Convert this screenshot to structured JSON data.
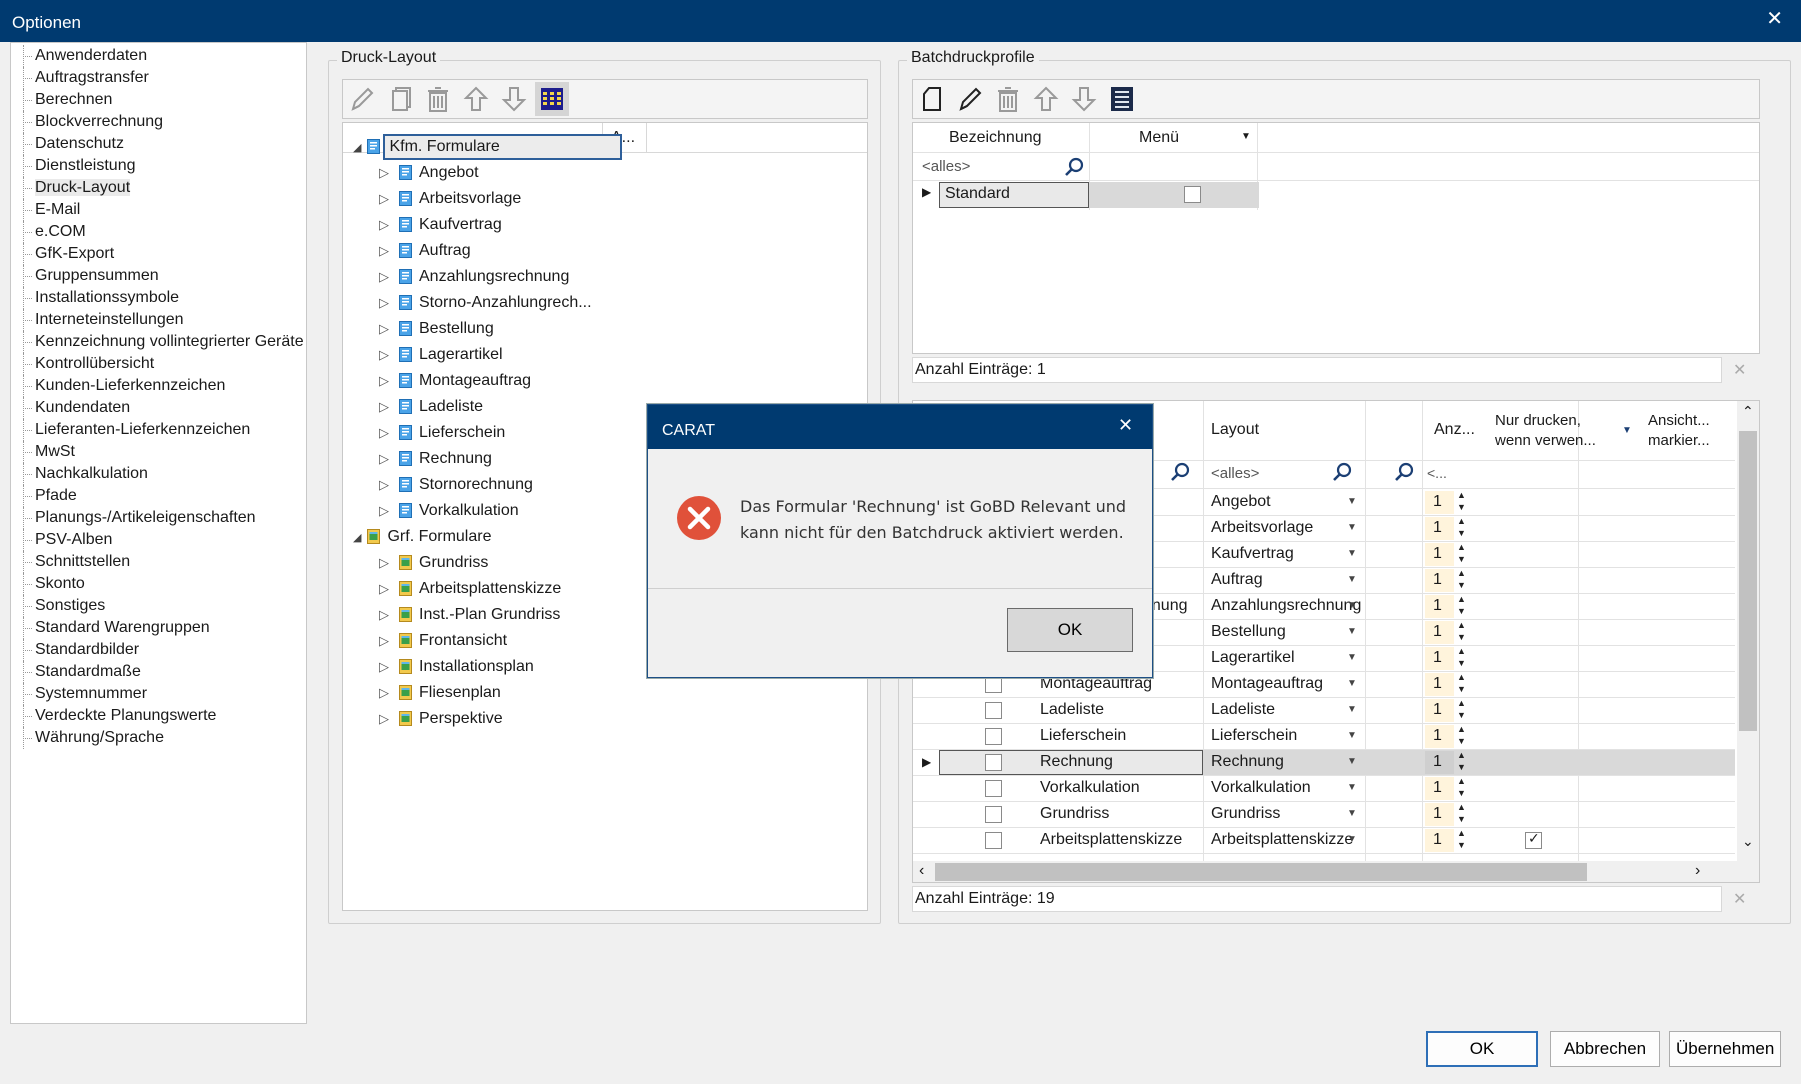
{
  "window": {
    "title": "Optionen",
    "close_glyph": "✕"
  },
  "nav": {
    "items": [
      "Anwenderdaten",
      "Auftragstransfer",
      "Berechnen",
      "Blockverrechnung",
      "Datenschutz",
      "Dienstleistung",
      "Druck-Layout",
      "E-Mail",
      "e.COM",
      "GfK-Export",
      "Gruppensummen",
      "Installationssymbole",
      "Interneteinstellungen",
      "Kennzeichnung vollintegrierter Geräte",
      "Kontrollübersicht",
      "Kunden-Lieferkennzeichen",
      "Kundendaten",
      "Lieferanten-Lieferkennzeichen",
      "MwSt",
      "Nachkalkulation",
      "Pfade",
      "Planungs-/Artikeleigenschaften",
      "PSV-Alben",
      "Schnittstellen",
      "Skonto",
      "Sonstiges",
      "Standard Warengruppen",
      "Standardbilder",
      "Standardmaße",
      "Systemnummer",
      "Verdeckte Planungswerte",
      "Währung/Sprache"
    ],
    "selected": "Druck-Layout"
  },
  "druck_layout": {
    "label": "Druck-Layout",
    "column_header": "A...",
    "kfm": {
      "label": "Kfm. Formulare",
      "items": [
        "Angebot",
        "Arbeitsvorlage",
        "Kaufvertrag",
        "Auftrag",
        "Anzahlungsrechnung",
        "Storno-Anzahlungrech...",
        "Bestellung",
        "Lagerartikel",
        "Montageauftrag",
        "Ladeliste",
        "Lieferschein",
        "Rechnung",
        "Stornorechnung",
        "Vorkalkulation"
      ]
    },
    "grf": {
      "label": "Grf. Formulare",
      "items": [
        "Grundriss",
        "Arbeitsplattenskizze",
        "Inst.-Plan Grundriss",
        "Frontansicht",
        "Installationsplan",
        "Fliesenplan",
        "Perspektive"
      ]
    },
    "icons": [
      "pencil-icon",
      "copy-icon",
      "trash-icon",
      "arrow-up-icon",
      "arrow-down-icon",
      "grid-icon"
    ]
  },
  "batch": {
    "label": "Batchdruckprofile",
    "headers": {
      "bezeichnung": "Bezeichnung",
      "menu": "Menü"
    },
    "filter_placeholder": "<alles>",
    "rows": [
      {
        "name": "Standard",
        "menu": false
      }
    ],
    "count_label": "Anzahl Einträge: 1"
  },
  "layouts": {
    "headers": {
      "layout": "Layout",
      "anz": "Anz...",
      "nur_drucken": "Nur drucken,\nwenn verwen...",
      "ansicht": "Ansicht...\nmarkier..."
    },
    "filter_all": "<alles>",
    "filter_short": "<...",
    "rows": [
      {
        "name": "",
        "layout": "Angebot",
        "qty": "1",
        "check": false,
        "show_checkbox": false
      },
      {
        "name": "",
        "layout": "Arbeitsvorlage",
        "qty": "1",
        "check": false,
        "show_checkbox": false
      },
      {
        "name": "",
        "layout": "Kaufvertrag",
        "qty": "1",
        "check": false,
        "show_checkbox": false
      },
      {
        "name": "",
        "layout": "Auftrag",
        "qty": "1",
        "check": false,
        "show_checkbox": false
      },
      {
        "name": "nnung",
        "layout": "Anzahlungsrechnung",
        "qty": "1",
        "check": false,
        "show_checkbox": false
      },
      {
        "name": "",
        "layout": "Bestellung",
        "qty": "1",
        "check": false,
        "show_checkbox": false
      },
      {
        "name": "",
        "layout": "Lagerartikel",
        "qty": "1",
        "check": false,
        "show_checkbox": false
      },
      {
        "name": "Montageauftrag",
        "layout": "Montageauftrag",
        "qty": "1",
        "check": false,
        "show_checkbox": true
      },
      {
        "name": "Ladeliste",
        "layout": "Ladeliste",
        "qty": "1",
        "check": false,
        "show_checkbox": true
      },
      {
        "name": "Lieferschein",
        "layout": "Lieferschein",
        "qty": "1",
        "check": false,
        "show_checkbox": true
      },
      {
        "name": "Rechnung",
        "layout": "Rechnung",
        "qty": "1",
        "check": false,
        "show_checkbox": true,
        "selected": true
      },
      {
        "name": "Vorkalkulation",
        "layout": "Vorkalkulation",
        "qty": "1",
        "check": false,
        "show_checkbox": true
      },
      {
        "name": "Grundriss",
        "layout": "Grundriss",
        "qty": "1",
        "check": false,
        "show_checkbox": true
      },
      {
        "name": "Arbeitsplattenskizze",
        "layout": "Arbeitsplattenskizze",
        "qty": "1",
        "check": false,
        "show_checkbox": true,
        "ansicht_checked": true
      }
    ],
    "count_label": "Anzahl Einträge: 19"
  },
  "dialog": {
    "title": "CARAT",
    "message": "Das Formular 'Rechnung' ist GoBD Relevant und\nkann nicht für den Batchdruck aktiviert werden.",
    "ok_label": "OK",
    "icon": "error-icon"
  },
  "footer": {
    "ok": "OK",
    "cancel": "Abbrechen",
    "apply": "Übernehmen"
  },
  "colors": {
    "titlebar": "#003a70",
    "error": "#e0513a",
    "accent": "#2e6fb7",
    "qty_bg": "#fff4dc"
  }
}
